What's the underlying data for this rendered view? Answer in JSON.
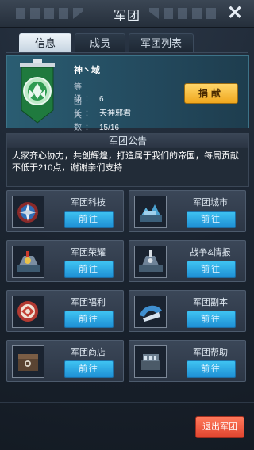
{
  "header": {
    "title": "军团",
    "close_label": "✕"
  },
  "tabs": [
    {
      "label": "信息",
      "active": true
    },
    {
      "label": "成员",
      "active": false
    },
    {
      "label": "军团列表",
      "active": false
    }
  ],
  "guild": {
    "name": "神丶域",
    "level_label": "等 级：",
    "level_value": "6",
    "leader_label": "团 长：",
    "leader_value": "天神邪君",
    "members_label": "人 数：",
    "members_value": "15/16",
    "donate_label": "捐献"
  },
  "announcement": {
    "title": "军团公告",
    "text": "大家齐心协力，共创辉煌，打造属于我们的帝国，每周贡献不低于210点，谢谢亲们支持"
  },
  "features": [
    {
      "label": "军团科技",
      "button": "前往",
      "icon": "tech-icon"
    },
    {
      "label": "军团城市",
      "button": "前往",
      "icon": "city-icon"
    },
    {
      "label": "军团荣耀",
      "button": "前往",
      "icon": "honor-icon"
    },
    {
      "label": "战争&情报",
      "button": "前往",
      "icon": "war-intel-icon"
    },
    {
      "label": "军团福利",
      "button": "前往",
      "icon": "welfare-icon"
    },
    {
      "label": "军团副本",
      "button": "前往",
      "icon": "dungeon-icon"
    },
    {
      "label": "军团商店",
      "button": "前往",
      "icon": "shop-icon"
    },
    {
      "label": "军团帮助",
      "button": "前往",
      "icon": "help-icon"
    }
  ],
  "footer": {
    "exit_label": "退出军团"
  },
  "colors": {
    "accent_blue": "#1e8fd4",
    "donate_gold": "#f0a81e",
    "exit_red": "#e0452f",
    "panel_teal": "#2a5d72"
  }
}
